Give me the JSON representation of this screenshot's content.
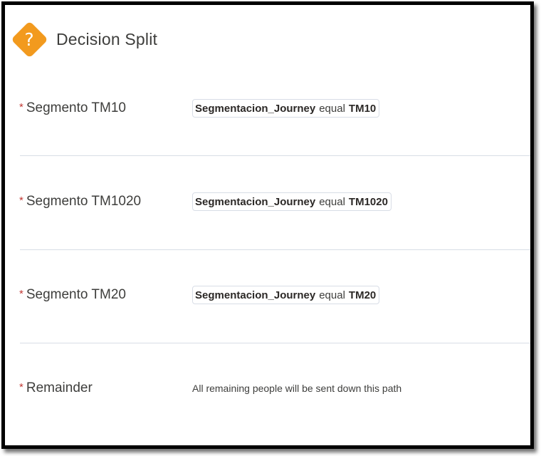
{
  "header": {
    "icon": "decision-diamond-icon",
    "icon_glyph": "?",
    "icon_color": "#f29a1e",
    "title": "Decision Split"
  },
  "required_marker": "*",
  "paths": [
    {
      "label": "Segmento TM10",
      "field": "Segmentacion_Journey",
      "operator": "equal",
      "value": "TM10"
    },
    {
      "label": "Segmento TM1020",
      "field": "Segmentacion_Journey",
      "operator": "equal",
      "value": "TM1020"
    },
    {
      "label": "Segmento TM20",
      "field": "Segmentacion_Journey",
      "operator": "equal",
      "value": "TM20"
    }
  ],
  "remainder": {
    "label": "Remainder",
    "description": "All remaining people will be sent down this path"
  }
}
